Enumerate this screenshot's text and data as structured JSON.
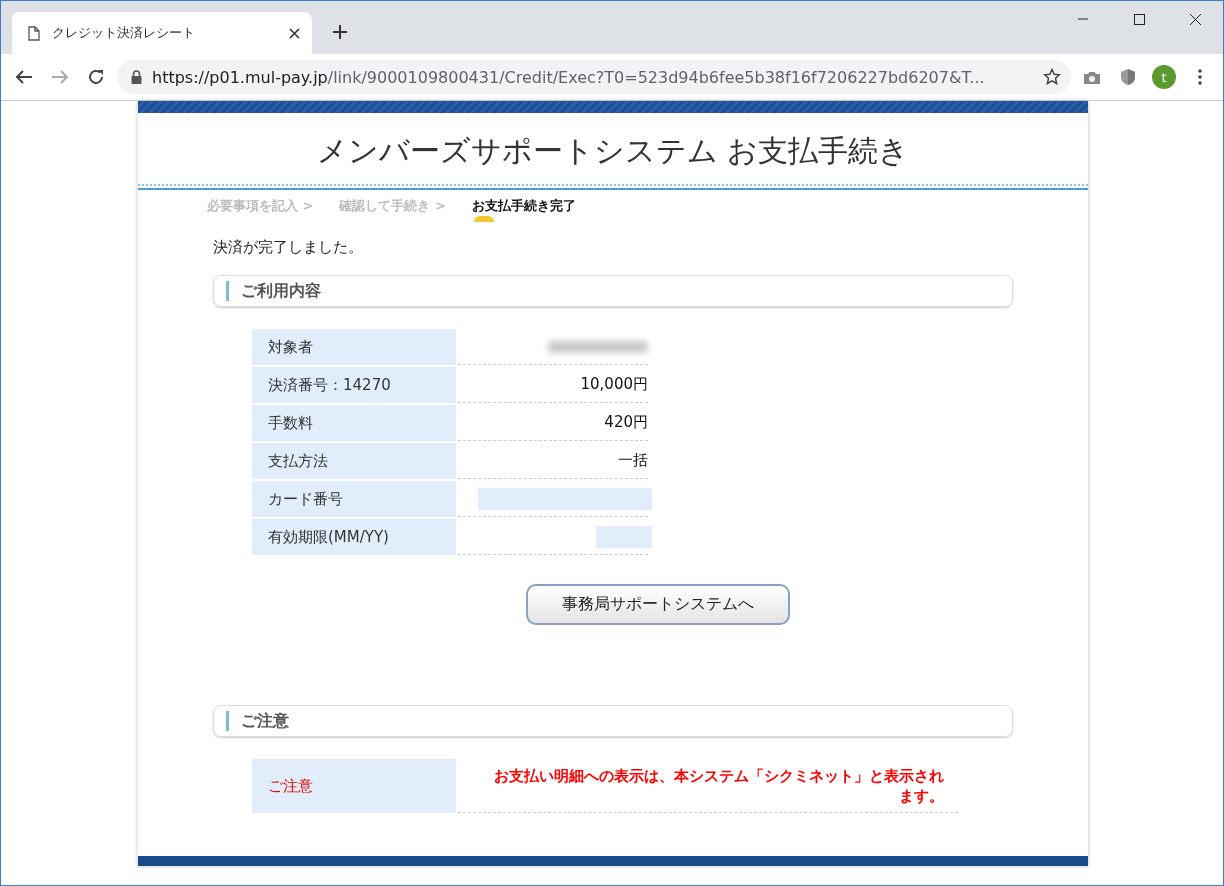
{
  "browser": {
    "tab_title": "クレジット決済レシート",
    "url_host": "https://p01.mul-pay.jp",
    "url_path": "/link/9000109800431/Credit/Exec?T0=523d94b6fee5b38f16f7206227bd6207&T...",
    "profile_initial": "t"
  },
  "page": {
    "title": "メンバーズサポートシステム お支払手続き",
    "steps": [
      {
        "label": "必要事項を記入 >",
        "selected": false
      },
      {
        "label": "確認して手続き >",
        "selected": false
      },
      {
        "label": "お支払手続き完了",
        "selected": true
      }
    ],
    "message": "決済が完了しました。",
    "usage_section": {
      "heading": "ご利用内容",
      "rows": [
        {
          "label": "対象者",
          "kind": "blurred"
        },
        {
          "label": "決済番号：14270",
          "kind": "text",
          "value": "10,000円"
        },
        {
          "label": "手数料",
          "kind": "text",
          "value": "420円"
        },
        {
          "label": "支払方法",
          "kind": "text",
          "value": "一括"
        },
        {
          "label": "カード番号",
          "kind": "masked"
        },
        {
          "label": "有効期限(MM/YY)",
          "kind": "masked_short"
        }
      ]
    },
    "button": "事務局サポートシステムへ",
    "notice_section": {
      "heading": "ご注意",
      "rows": [
        {
          "label": "ご注意",
          "kind": "warning",
          "value": "お支払い明細への表示は、本システム「シクミネット」と表示されます。"
        }
      ]
    }
  }
}
